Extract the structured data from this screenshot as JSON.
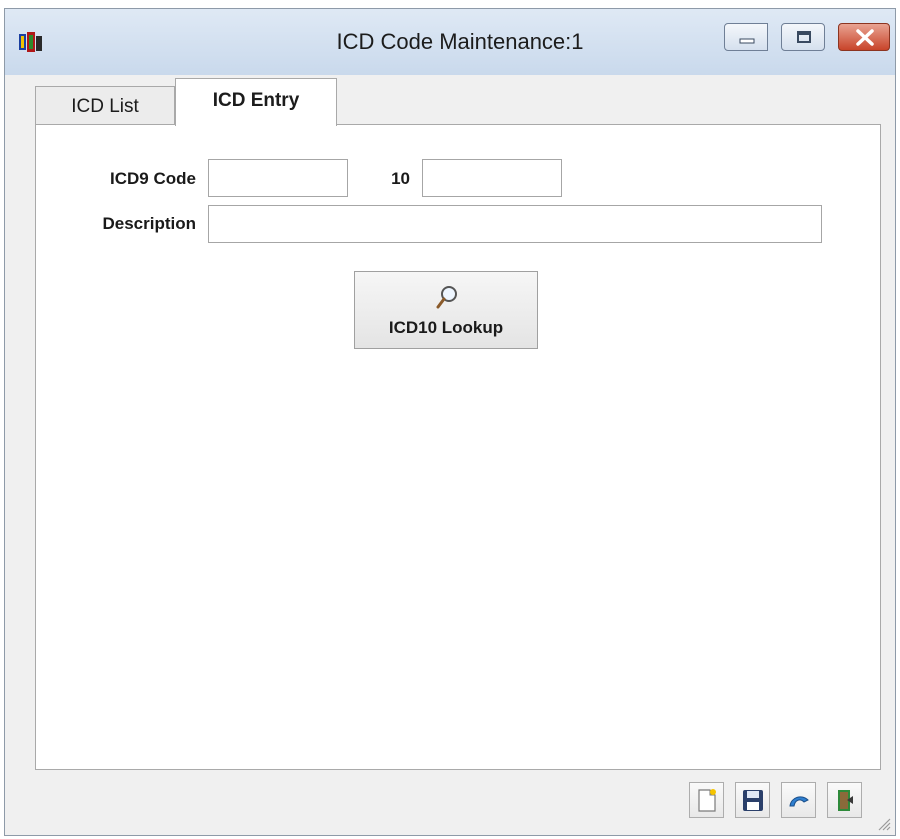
{
  "window": {
    "title": "ICD Code Maintenance:1",
    "controls": [
      "minimize-icon",
      "maximize-icon",
      "close-icon"
    ]
  },
  "tabs": [
    {
      "label": "ICD List",
      "selected": false
    },
    {
      "label": "ICD Entry",
      "selected": true
    }
  ],
  "form": {
    "icd9_label": "ICD9 Code",
    "icd9_value": "",
    "icd10_label": "10",
    "icd10_value": "",
    "description_label": "Description",
    "description_value": ""
  },
  "lookup": {
    "label": "ICD10 Lookup",
    "icon": "magnifier-icon"
  },
  "toolbar": {
    "icons": [
      "new-document-icon",
      "save-icon",
      "undo-icon",
      "exit-icon"
    ]
  },
  "colors": {
    "titlebar": "#c9d9ec",
    "close_button": "#c8442a",
    "window_bg": "#f0f0f0",
    "panel_bg": "#ffffff"
  }
}
